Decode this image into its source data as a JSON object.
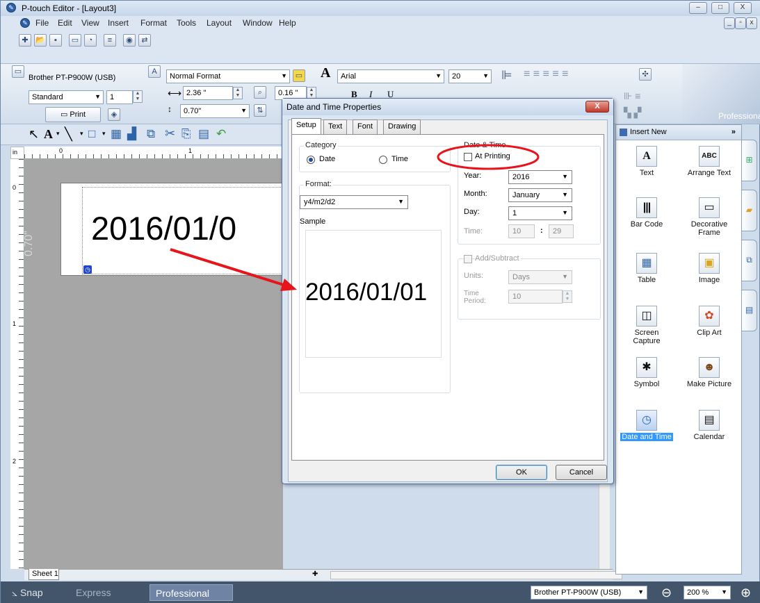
{
  "window": {
    "title": "P-touch Editor - [Layout3]",
    "icon": "p-touch-app-icon",
    "controls": {
      "minimize": "–",
      "maximize": "□",
      "close": "X"
    }
  },
  "menubar": {
    "items": [
      "File",
      "Edit",
      "View",
      "Insert",
      "Format",
      "Tools",
      "Layout",
      "Window",
      "Help"
    ]
  },
  "ribbon": {
    "printer": "Brother PT-P900W (USB)",
    "print_mode": "Standard",
    "copies": "1",
    "print_button": "Print",
    "format_name": "Normal Format",
    "width_value": "2.36 \"",
    "margin_value": "0.16 \"",
    "length_value": "0.70\"",
    "font_name": "Arial",
    "font_size": "20",
    "brand_label": "Professional"
  },
  "editor": {
    "ruler_unit": "in",
    "ruler_h_marks": [
      "0",
      "1"
    ],
    "ruler_v_marks": [
      "0",
      "1",
      "2"
    ],
    "label_text": "2016/01/0",
    "label_height": "0.70\"",
    "sheet_tab": "Sheet 1"
  },
  "statusbar": {
    "snap": "Snap",
    "express": "Express",
    "professional": "Professional",
    "printer": "Brother PT-P900W (USB)",
    "zoom": "200 %"
  },
  "insert_panel": {
    "title": "Insert New",
    "items": [
      {
        "label": "Text",
        "icon": "A"
      },
      {
        "label": "Arrange Text",
        "icon": "ABC"
      },
      {
        "label": "Bar Code",
        "icon": "|||"
      },
      {
        "label": "Decorative Frame",
        "icon": "▭"
      },
      {
        "label": "Table",
        "icon": "▦"
      },
      {
        "label": "Image",
        "icon": "▣"
      },
      {
        "label": "Screen Capture",
        "icon": "◫"
      },
      {
        "label": "Clip Art",
        "icon": "✿"
      },
      {
        "label": "Symbol",
        "icon": "✱"
      },
      {
        "label": "Make Picture",
        "icon": "☻"
      },
      {
        "label": "Date and Time",
        "icon": "◷",
        "selected": true
      },
      {
        "label": "Calendar",
        "icon": "▤"
      }
    ]
  },
  "dialog": {
    "title": "Date and Time Properties",
    "close": "X",
    "tabs": [
      "Setup",
      "Text",
      "Font",
      "Drawing"
    ],
    "active_tab": "Setup",
    "category_title": "Category",
    "category_date": "Date",
    "category_time": "Time",
    "format_title": "Format:",
    "format_value": "y4/m2/d2",
    "sample_title": "Sample",
    "sample_text": "2016/01/01",
    "date_time_title": "Date & Time",
    "at_printing": "At Printing",
    "year_label": "Year:",
    "year_value": "2016",
    "month_label": "Month:",
    "month_value": "January",
    "day_label": "Day:",
    "day_value": "1",
    "time_label": "Time:",
    "time_hour": "10",
    "time_sep": ":",
    "time_min": "29",
    "add_subtract": "Add/Subtract",
    "units_label": "Units:",
    "units_value": "Days",
    "time_period_label": "Time Period:",
    "time_period_value": "10",
    "ok": "OK",
    "cancel": "Cancel"
  },
  "annotation_colors": {
    "arrow": "#e8141b",
    "circle": "#e8141b"
  }
}
